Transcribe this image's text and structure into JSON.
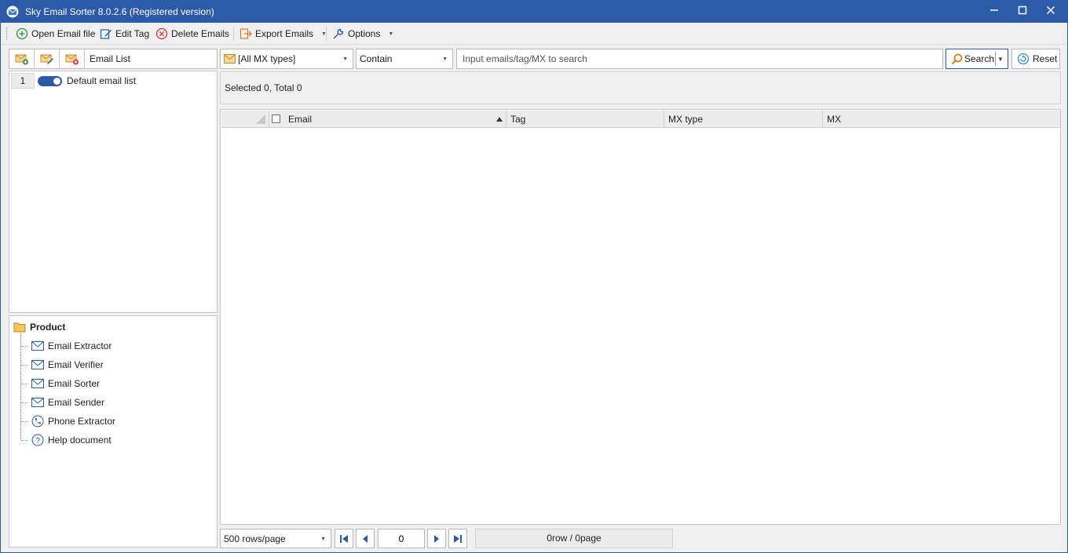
{
  "window": {
    "title": "Sky Email Sorter 8.0.2.6 (Registered version)",
    "minimize": "—",
    "maximize": "☐",
    "close": "✕"
  },
  "toolbar": {
    "open_email_file": "Open Email file",
    "edit_tag": "Edit Tag",
    "delete_emails": "Delete Emails",
    "export_emails": "Export Emails",
    "options": "Options"
  },
  "left_panel": {
    "header_title": "Email List",
    "lists": [
      {
        "index": "1",
        "label": "Default email list",
        "enabled": true
      }
    ]
  },
  "tree": {
    "root": "Product",
    "items": [
      {
        "label": "Email Extractor",
        "icon": "envelope-icon"
      },
      {
        "label": "Email Verifier",
        "icon": "envelope-icon"
      },
      {
        "label": "Email Sorter",
        "icon": "envelope-icon"
      },
      {
        "label": "Email Sender",
        "icon": "envelope-icon"
      },
      {
        "label": "Phone Extractor",
        "icon": "phone-icon"
      },
      {
        "label": "Help document",
        "icon": "help-icon"
      }
    ]
  },
  "filter": {
    "mx_type": "[All MX types]",
    "match_mode": "Contain",
    "search_placeholder": "Input emails/tag/MX to search",
    "search_label": "Search",
    "reset_label": "Reset"
  },
  "status": {
    "text": "Selected 0, Total 0"
  },
  "grid": {
    "columns": [
      "Email",
      "Tag",
      "MX type",
      "MX"
    ],
    "sorted_column": "Email",
    "sort_direction": "ascending",
    "rows": []
  },
  "pager": {
    "rows_per_page": "500 rows/page",
    "current_page": "0",
    "page_info": "0row / 0page"
  },
  "colors": {
    "titlebar": "#2b5aa8",
    "accent_orange": "#e07a1f",
    "delete_red": "#d9342b"
  }
}
